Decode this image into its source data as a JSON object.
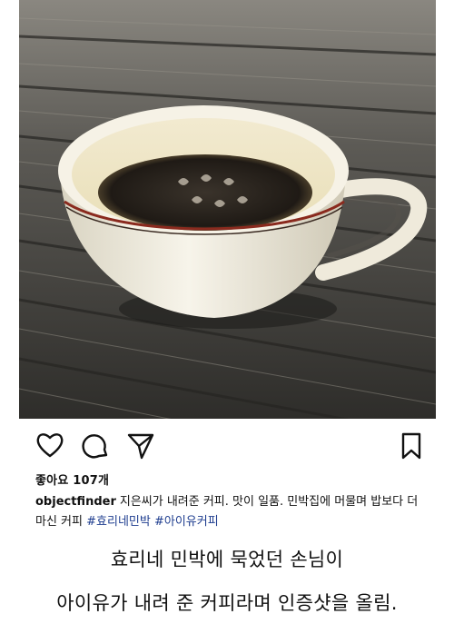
{
  "post": {
    "photo_alt": "coffee cup on wooden deck",
    "likes_label": "좋아요 107개",
    "username": "objectfinder",
    "caption_text": "지은씨가 내려준 커피. 맛이 일품. 민박집에 머물며 밥보다 더 마신 커피",
    "hashtags": [
      "#효리네민박",
      "#아이유커피"
    ],
    "icons": [
      "heart-icon",
      "comment-icon",
      "share-icon",
      "bookmark-icon"
    ]
  },
  "overlay": {
    "line1": "효리네 민박에 묵었던 손님이",
    "line2": "아이유가 내려 준 커피라며 인증샷을 올림."
  },
  "colors": {
    "hashtag": "#1e3d8f",
    "text": "#111111"
  }
}
